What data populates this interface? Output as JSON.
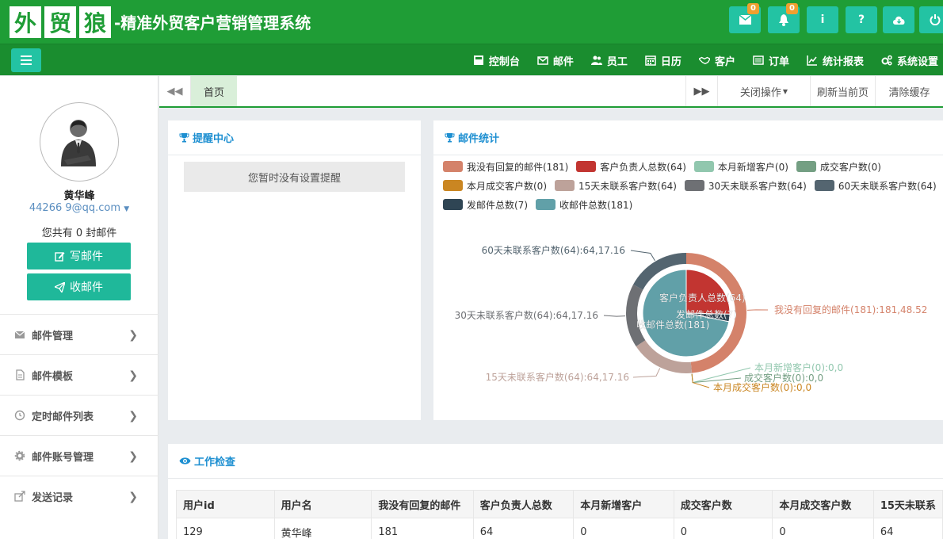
{
  "header": {
    "logo_chars": [
      "外",
      "贸",
      "狼"
    ],
    "slogan": "-精准外贸客户营销管理系统",
    "mail_badge": "0",
    "bell_badge": "0",
    "info_label": "i",
    "help_label": "?"
  },
  "nav": {
    "items": [
      {
        "label": "控制台",
        "icon": "dashboard-icon"
      },
      {
        "label": "邮件",
        "icon": "envelope-icon"
      },
      {
        "label": "员工",
        "icon": "users-icon"
      },
      {
        "label": "日历",
        "icon": "calendar-icon"
      },
      {
        "label": "客户",
        "icon": "handshake-icon"
      },
      {
        "label": "订单",
        "icon": "list-icon"
      },
      {
        "label": "统计报表",
        "icon": "line-chart-icon"
      },
      {
        "label": "系统设置",
        "icon": "gears-icon"
      }
    ]
  },
  "sidebar": {
    "user_name": "黄华峰",
    "user_email": "44266      9@qq.com",
    "mail_count_prefix": "您共有",
    "mail_count": "0",
    "mail_count_suffix": "封邮件",
    "write_label": "写邮件",
    "receive_label": "收邮件",
    "menu": [
      {
        "label": "邮件管理",
        "icon": "envelope-icon"
      },
      {
        "label": "邮件模板",
        "icon": "file-icon"
      },
      {
        "label": "定时邮件列表",
        "icon": "clock-icon"
      },
      {
        "label": "邮件账号管理",
        "icon": "gear-icon"
      },
      {
        "label": "发送记录",
        "icon": "share-icon"
      }
    ]
  },
  "tabs": {
    "home": "首页",
    "close_ops": "关闭操作",
    "refresh": "刷新当前页",
    "clear_cache": "清除缓存"
  },
  "reminder": {
    "title": "提醒中心",
    "empty": "您暂时没有设置提醒"
  },
  "mail_stats": {
    "title": "邮件统计"
  },
  "chart_data": {
    "type": "pie",
    "legend": [
      {
        "name": "我没有回复的邮件(181)",
        "color": "#d4826a"
      },
      {
        "name": "客户负责人总数(64)",
        "color": "#c23531"
      },
      {
        "name": "本月新增客户(0)",
        "color": "#91c7ae"
      },
      {
        "name": "成交客户数(0)",
        "color": "#749f83"
      },
      {
        "name": "本月成交客户数(0)",
        "color": "#ca8622"
      },
      {
        "name": "15天未联系客户数(64)",
        "color": "#bda29a"
      },
      {
        "name": "30天未联系客户数(64)",
        "color": "#6e7074"
      },
      {
        "name": "60天未联系客户数(64)",
        "color": "#546570"
      },
      {
        "name": "发邮件总数(7)",
        "color": "#2f4554"
      },
      {
        "name": "收邮件总数(181)",
        "color": "#61a0a8"
      }
    ],
    "inner_series": [
      {
        "name": "客户负责人总数(64)",
        "value": 64,
        "color": "#c23531"
      },
      {
        "name": "发邮件总数(7)",
        "value": 7,
        "color": "#2f4554"
      },
      {
        "name": "收邮件总数(181)",
        "value": 181,
        "color": "#61a0a8"
      }
    ],
    "outer_series": [
      {
        "name": "我没有回复的邮件(181)",
        "value": 181,
        "percent": 48.52,
        "color": "#d4826a"
      },
      {
        "name": "本月新增客户(0)",
        "value": 0,
        "percent": 0,
        "color": "#91c7ae"
      },
      {
        "name": "成交客户数(0)",
        "value": 0,
        "percent": 0,
        "color": "#749f83"
      },
      {
        "name": "本月成交客户数(0)",
        "value": 0,
        "percent": 0,
        "color": "#ca8622"
      },
      {
        "name": "15天未联系客户数(64)",
        "value": 64,
        "percent": 17.16,
        "color": "#bda29a"
      },
      {
        "name": "30天未联系客户数(64)",
        "value": 64,
        "percent": 17.16,
        "color": "#6e7074"
      },
      {
        "name": "60天未联系客户数(64)",
        "value": 64,
        "percent": 17.16,
        "color": "#546570"
      }
    ],
    "outer_labels": [
      {
        "text": "我没有回复的邮件(181):181,48.52",
        "color": "#d4826a"
      },
      {
        "text": "本月新增客户(0):0,0",
        "color": "#91c7ae"
      },
      {
        "text": "成交客户数(0):0,0",
        "color": "#749f83"
      },
      {
        "text": "本月成交客户数(0):0,0",
        "color": "#ca8622"
      },
      {
        "text": "15天未联系客户数(64):64,17.16",
        "color": "#bda29a"
      },
      {
        "text": "30天未联系客户数(64):64,17.16",
        "color": "#6e7074"
      },
      {
        "text": "60天未联系客户数(64):64,17.16",
        "color": "#546570"
      }
    ]
  },
  "work_check": {
    "title": "工作检查",
    "columns": [
      "用户id",
      "用户名",
      "我没有回复的邮件",
      "客户负责人总数",
      "本月新增客户",
      "成交客户数",
      "本月成交客户数",
      "15天未联系"
    ],
    "rows": [
      [
        "129",
        "黄华峰",
        "181",
        "64",
        "0",
        "0",
        "0",
        "64"
      ]
    ]
  },
  "colors": {
    "header_green": "#1f9d36",
    "teal_button": "#23c3a3",
    "title_blue": "#1d8fd1"
  }
}
